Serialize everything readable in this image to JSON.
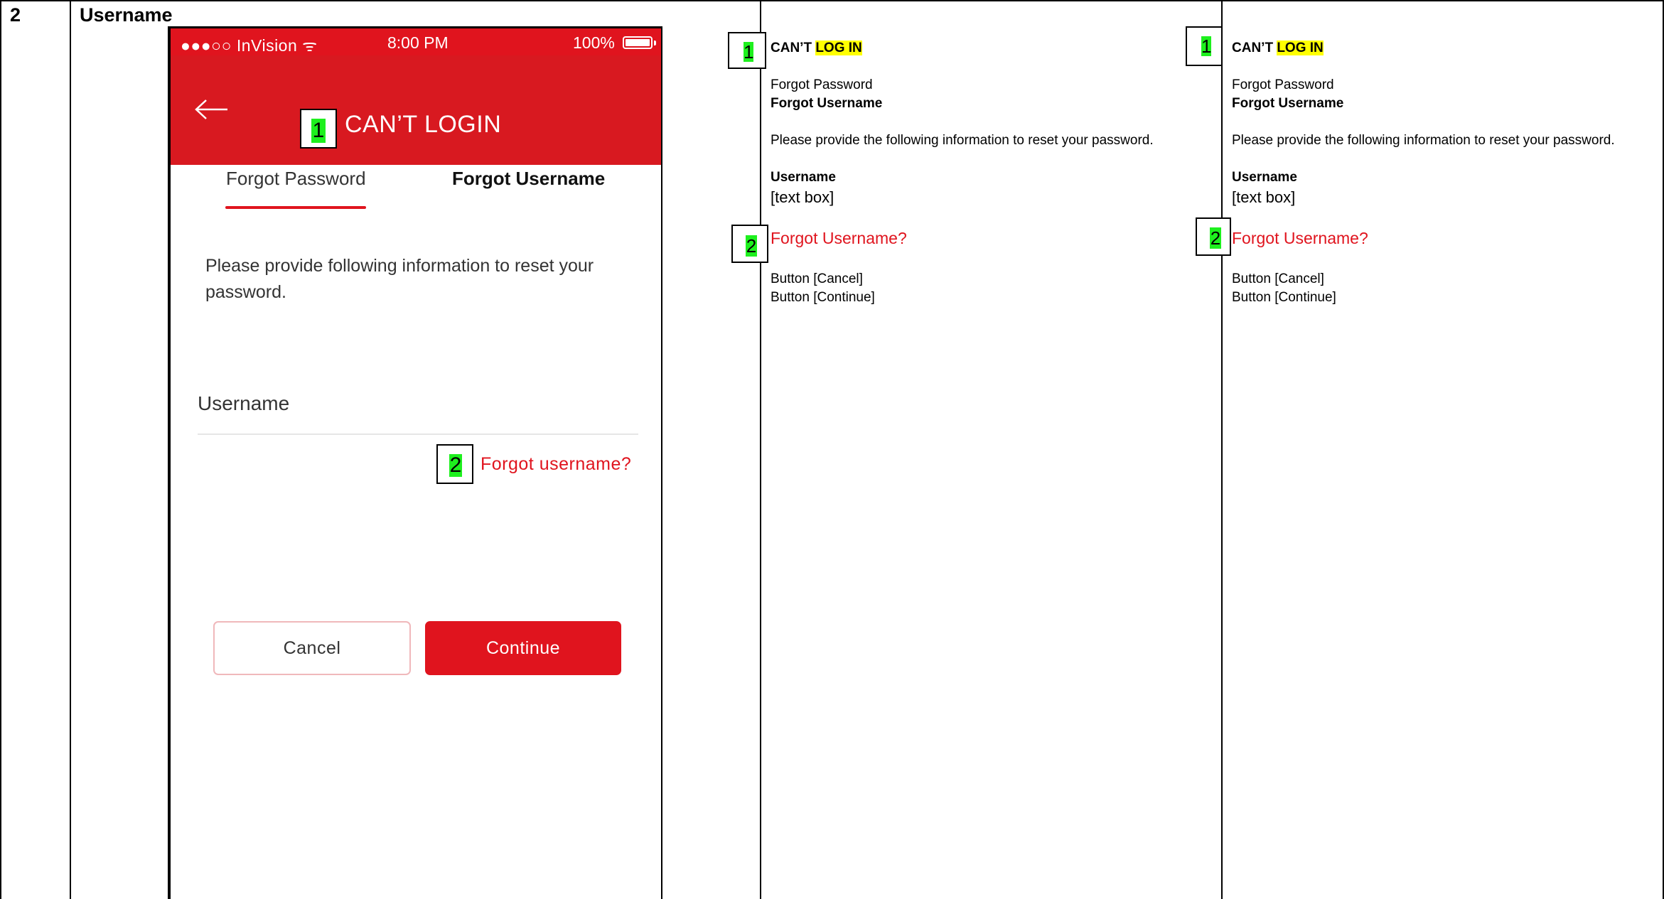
{
  "row": {
    "number": "2",
    "title": "Username"
  },
  "phone": {
    "status": {
      "carrier": "●●●○○ InVision ᯤ",
      "time": "8:00 PM",
      "battery": "100%"
    },
    "header_title": "CAN’T LOGIN",
    "header_marker": "1",
    "tabs": {
      "password": "Forgot Password",
      "username": "Forgot Username"
    },
    "instructions": "Please provide following information to reset your password.",
    "field_label": "Username",
    "forgot_marker": "2",
    "forgot_link": "Forgot username?",
    "cancel": "Cancel",
    "continue": "Continue",
    "colors": {
      "brand": "#d81920",
      "accent": "#e0141e",
      "marker": "#1ef01e"
    }
  },
  "spec_columns": [
    {
      "marker1": "1",
      "title_a": "CAN’T ",
      "title_b": "LOG IN",
      "tab1": "Forgot Password",
      "tab2": "Forgot Username",
      "instructions": "Please provide the following information to reset your password.",
      "field_label": "Username",
      "field_value": "[text box]",
      "marker2": "2",
      "link": "Forgot Username?",
      "button1": "Button [Cancel]",
      "button2": "Button [Continue]"
    },
    {
      "marker1": "1",
      "title_a": "CAN’T ",
      "title_b": "LOG IN",
      "tab1": "Forgot Password",
      "tab2": "Forgot Username",
      "instructions": "Please provide the following information to reset your password.",
      "field_label": "Username",
      "field_value": "[text box]",
      "marker2": "2",
      "link": "Forgot Username?",
      "button1": "Button [Cancel]",
      "button2": "Button [Continue]"
    }
  ]
}
